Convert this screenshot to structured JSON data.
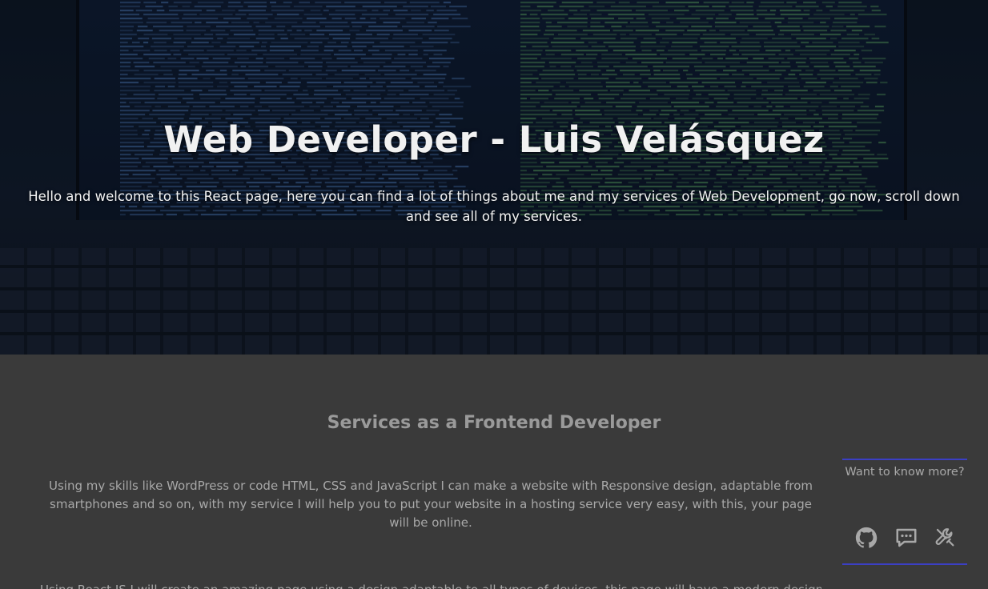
{
  "hero": {
    "title": "Web Developer - Luis Velásquez",
    "intro": "Hello and welcome to this React page, here you can find a lot of things about me and my services of Web Development, go now, scroll down and see all of my services."
  },
  "services": {
    "title": "Services as a Frontend Developer",
    "paragraph_1": "Using my skills like WordPress or code HTML, CSS and JavaScript I can make a website with Responsive design, adaptable from smartphones and so on, with my service I will help you to put your website in a hosting service very easy, with this, your page will be online.",
    "paragraph_2": "Using React JS I will create an amazing page using a design adaptable to all types of devices, this page will have a modern design"
  },
  "contact": {
    "label": "Want to know more?",
    "icons": [
      "github-icon",
      "chat-icon",
      "tools-icon"
    ],
    "accent_color": "#3b3fc4"
  },
  "colors": {
    "background": "#3a3a3a",
    "hero_text": "#f1f1f1",
    "muted_text": "#a8a8a8"
  }
}
